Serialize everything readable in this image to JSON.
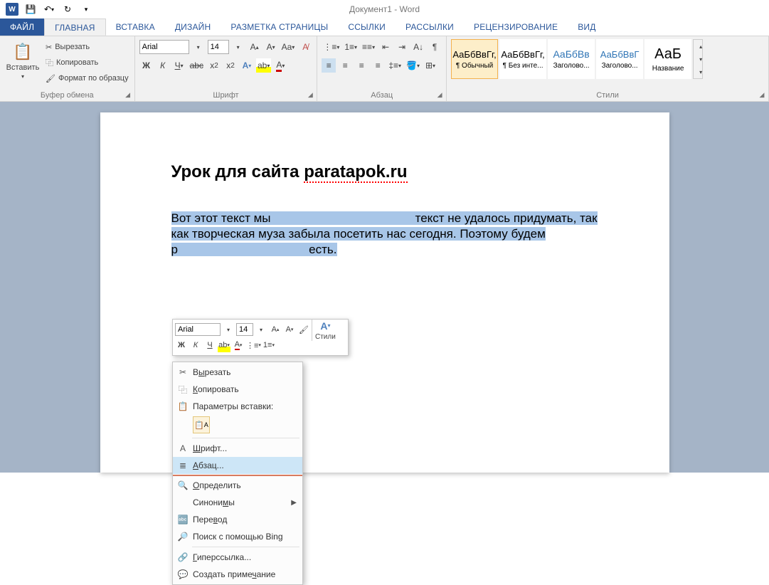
{
  "title": "Документ1 - Word",
  "tabs": {
    "file": "ФАЙЛ",
    "home": "ГЛАВНАЯ",
    "insert": "ВСТАВКА",
    "design": "ДИЗАЙН",
    "layout": "РАЗМЕТКА СТРАНИЦЫ",
    "refs": "ССЫЛКИ",
    "mail": "РАССЫЛКИ",
    "review": "РЕЦЕНЗИРОВАНИЕ",
    "view": "ВИД"
  },
  "clipboard": {
    "paste": "Вставить",
    "cut": "Вырезать",
    "copy": "Копировать",
    "fmtpaint": "Формат по образцу",
    "group": "Буфер обмена"
  },
  "font": {
    "name": "Arial",
    "size": "14",
    "group": "Шрифт"
  },
  "para": {
    "group": "Абзац"
  },
  "styles": {
    "group": "Стили",
    "items": [
      {
        "prev": "АаБбВвГг,",
        "label": "¶ Обычный"
      },
      {
        "prev": "АаБбВвГг,",
        "label": "¶ Без инте..."
      },
      {
        "prev": "АаБбВв",
        "label": "Заголово..."
      },
      {
        "prev": "АаБбВвГ",
        "label": "Заголово..."
      },
      {
        "prev": "АаБ",
        "label": "Название"
      }
    ]
  },
  "doc": {
    "title_pre": "Урок для сайта ",
    "title_spell": "paratapok.ru",
    "body_a": "Вот этот текст мы",
    "body_b": " текст не удалось придумать, так как творческая муза забыла посетить нас сегодня. Поэтому будем р",
    "body_c": "есть."
  },
  "mini": {
    "font": "Arial",
    "size": "14",
    "styles": "Стили"
  },
  "ctx": {
    "cut": "Вырезать",
    "copy": "Копировать",
    "paste_opts": "Параметры вставки:",
    "font": "Шрифт...",
    "para": "Абзац...",
    "define": "Определить",
    "syn": "Синонимы",
    "trans": "Перевод",
    "bing": "Поиск с помощью Bing",
    "link": "Гиперссылка...",
    "note": "Создать примечание"
  }
}
